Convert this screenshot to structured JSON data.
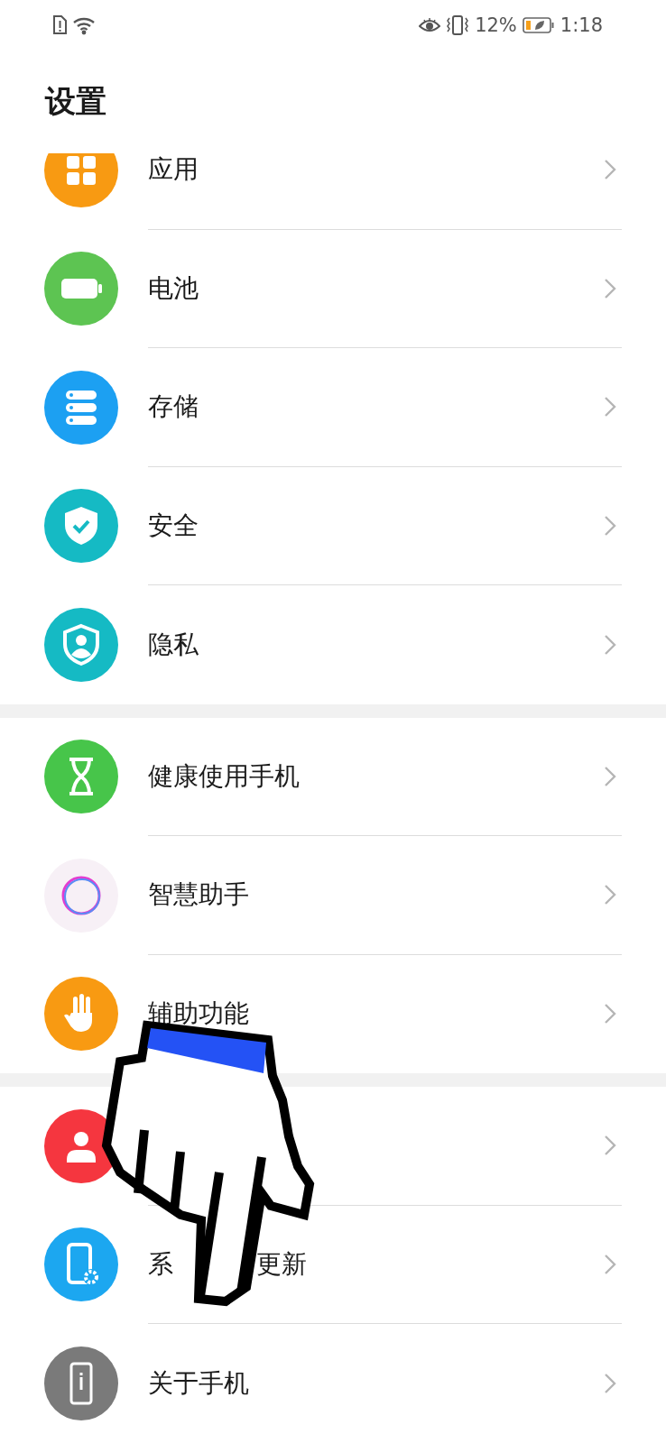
{
  "status_bar": {
    "battery_percent": "12%",
    "time": "1:18"
  },
  "title": "设置",
  "groups": [
    {
      "rows": [
        {
          "label": "应用"
        },
        {
          "label": "电池"
        },
        {
          "label": "存储"
        },
        {
          "label": "安全"
        },
        {
          "label": "隐私"
        }
      ]
    },
    {
      "rows": [
        {
          "label": "健康使用手机"
        },
        {
          "label": "智慧助手"
        },
        {
          "label": "辅助功能"
        }
      ]
    },
    {
      "rows": [
        {},
        {
          "label_parts": [
            "系",
            "更新"
          ]
        },
        {
          "label": "关于手机"
        }
      ]
    }
  ]
}
